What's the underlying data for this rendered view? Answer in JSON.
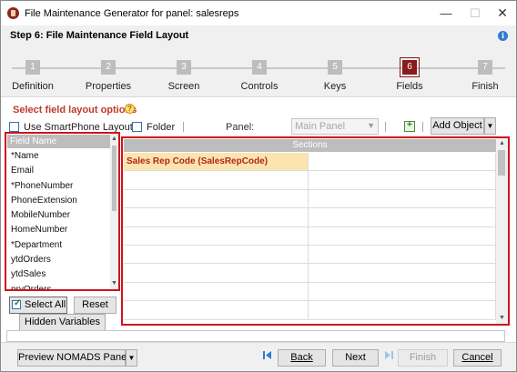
{
  "window": {
    "title": "File Maintenance Generator for panel: salesreps",
    "minimize_glyph": "—",
    "maximize_glyph": "☐",
    "close_glyph": "✕"
  },
  "header": {
    "step_title": "Step 6: File Maintenance Field Layout",
    "help_glyph": "i"
  },
  "steps": [
    {
      "number": "1",
      "label": "Definition"
    },
    {
      "number": "2",
      "label": "Properties"
    },
    {
      "number": "3",
      "label": "Screen"
    },
    {
      "number": "4",
      "label": "Controls"
    },
    {
      "number": "5",
      "label": "Keys"
    },
    {
      "number": "6",
      "label": "Fields",
      "active": true
    },
    {
      "number": "7",
      "label": "Finish"
    }
  ],
  "options": {
    "title": "Select field layout options",
    "info_glyph": "?",
    "smartphone_label": "Use SmartPhone Layout",
    "folder_label": "Folder",
    "panel_label": "Panel:",
    "panel_value": "Main Panel",
    "add_object_label": "Add Object",
    "dropdown_glyph": "▼"
  },
  "field_list": {
    "header": "Field Name",
    "items": [
      "*Name",
      "Email",
      "*PhoneNumber",
      "PhoneExtension",
      "MobileNumber",
      "HomeNumber",
      "*Department",
      "ytdOrders",
      "ytdSales",
      "pryOrders"
    ]
  },
  "sections": {
    "header": "Sections",
    "placed_field": "Sales Rep Code (SalesRepCode)"
  },
  "list_buttons": {
    "select_all": "Select All",
    "reset": "Reset",
    "hidden_variables": "Hidden Variables"
  },
  "footer": {
    "preview": "Preview NOMADS Panel",
    "back": "Back",
    "next": "Next",
    "finish": "Finish",
    "cancel": "Cancel"
  },
  "colors": {
    "accent_red": "#d0141c",
    "active_step": "#8b1a1a",
    "nav_icon_blue": "#2f7bd3",
    "highlight_cell": "#fce4b0"
  }
}
